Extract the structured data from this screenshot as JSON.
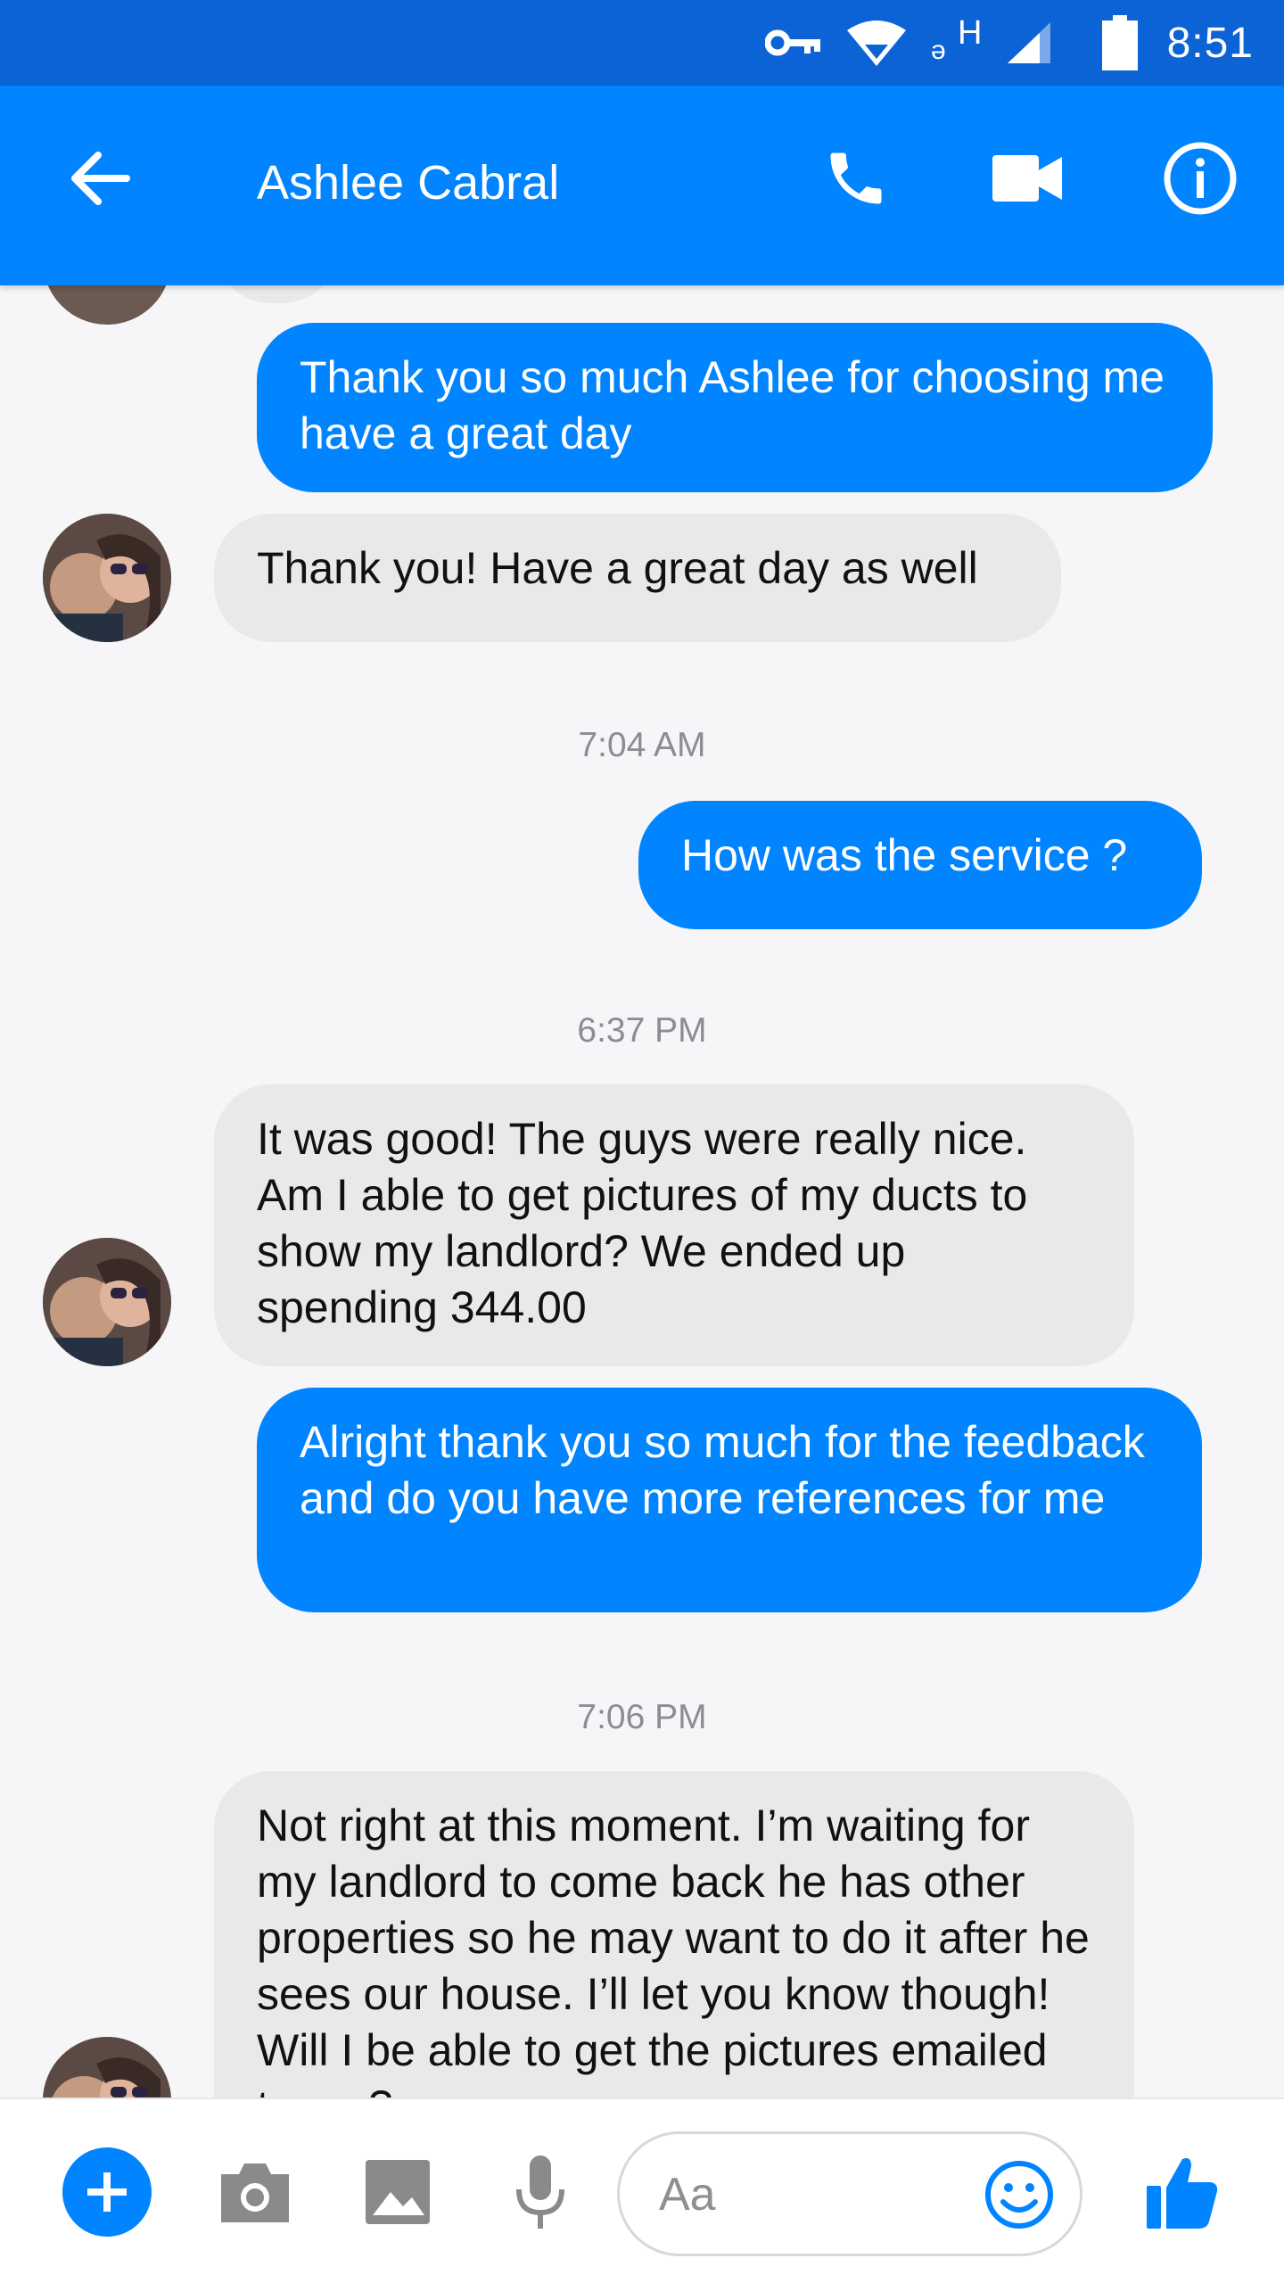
{
  "status_bar": {
    "time": "8:51",
    "icons": [
      "vpn-key-icon",
      "wifi-icon",
      "h-plus-icon",
      "signal-icon",
      "battery-icon"
    ],
    "network_label": "H"
  },
  "header": {
    "title": "Ashlee Cabral",
    "back_icon": "arrow-left-icon",
    "actions": [
      "phone-icon",
      "video-camera-icon",
      "info-icon"
    ]
  },
  "messages": [
    {
      "type": "out",
      "text": "Thank you so much Ashlee for choosing me have a great day"
    },
    {
      "type": "in",
      "text": "Thank you! Have a great day as well"
    },
    {
      "type": "timestamp",
      "text": "7:04 AM"
    },
    {
      "type": "out",
      "text": "How was the service ?"
    },
    {
      "type": "timestamp",
      "text": "6:37 PM"
    },
    {
      "type": "in",
      "text": "It was good! The guys were really nice. Am I able to get pictures of my ducts to show my landlord? We ended up spending 344.00"
    },
    {
      "type": "out",
      "text": "Alright thank you so much for the feedback and do you have more references for me"
    },
    {
      "type": "timestamp",
      "text": "7:06 PM"
    },
    {
      "type": "in",
      "text": "Not right at this moment. I’m waiting for my landlord to come back he has other properties so he may want to do it after he sees our house. I’ll let you know though! Will I be able to get the pictures emailed to me?"
    }
  ],
  "composer": {
    "placeholder": "Aa",
    "buttons": [
      "plus-icon",
      "camera-icon",
      "image-icon",
      "microphone-icon",
      "emoji-icon",
      "thumbs-up-icon"
    ]
  },
  "colors": {
    "accent": "#0084ff",
    "status_bar": "#0b63d6",
    "incoming_bubble": "#e9e9eb",
    "timestamp_text": "#8a8d91"
  }
}
